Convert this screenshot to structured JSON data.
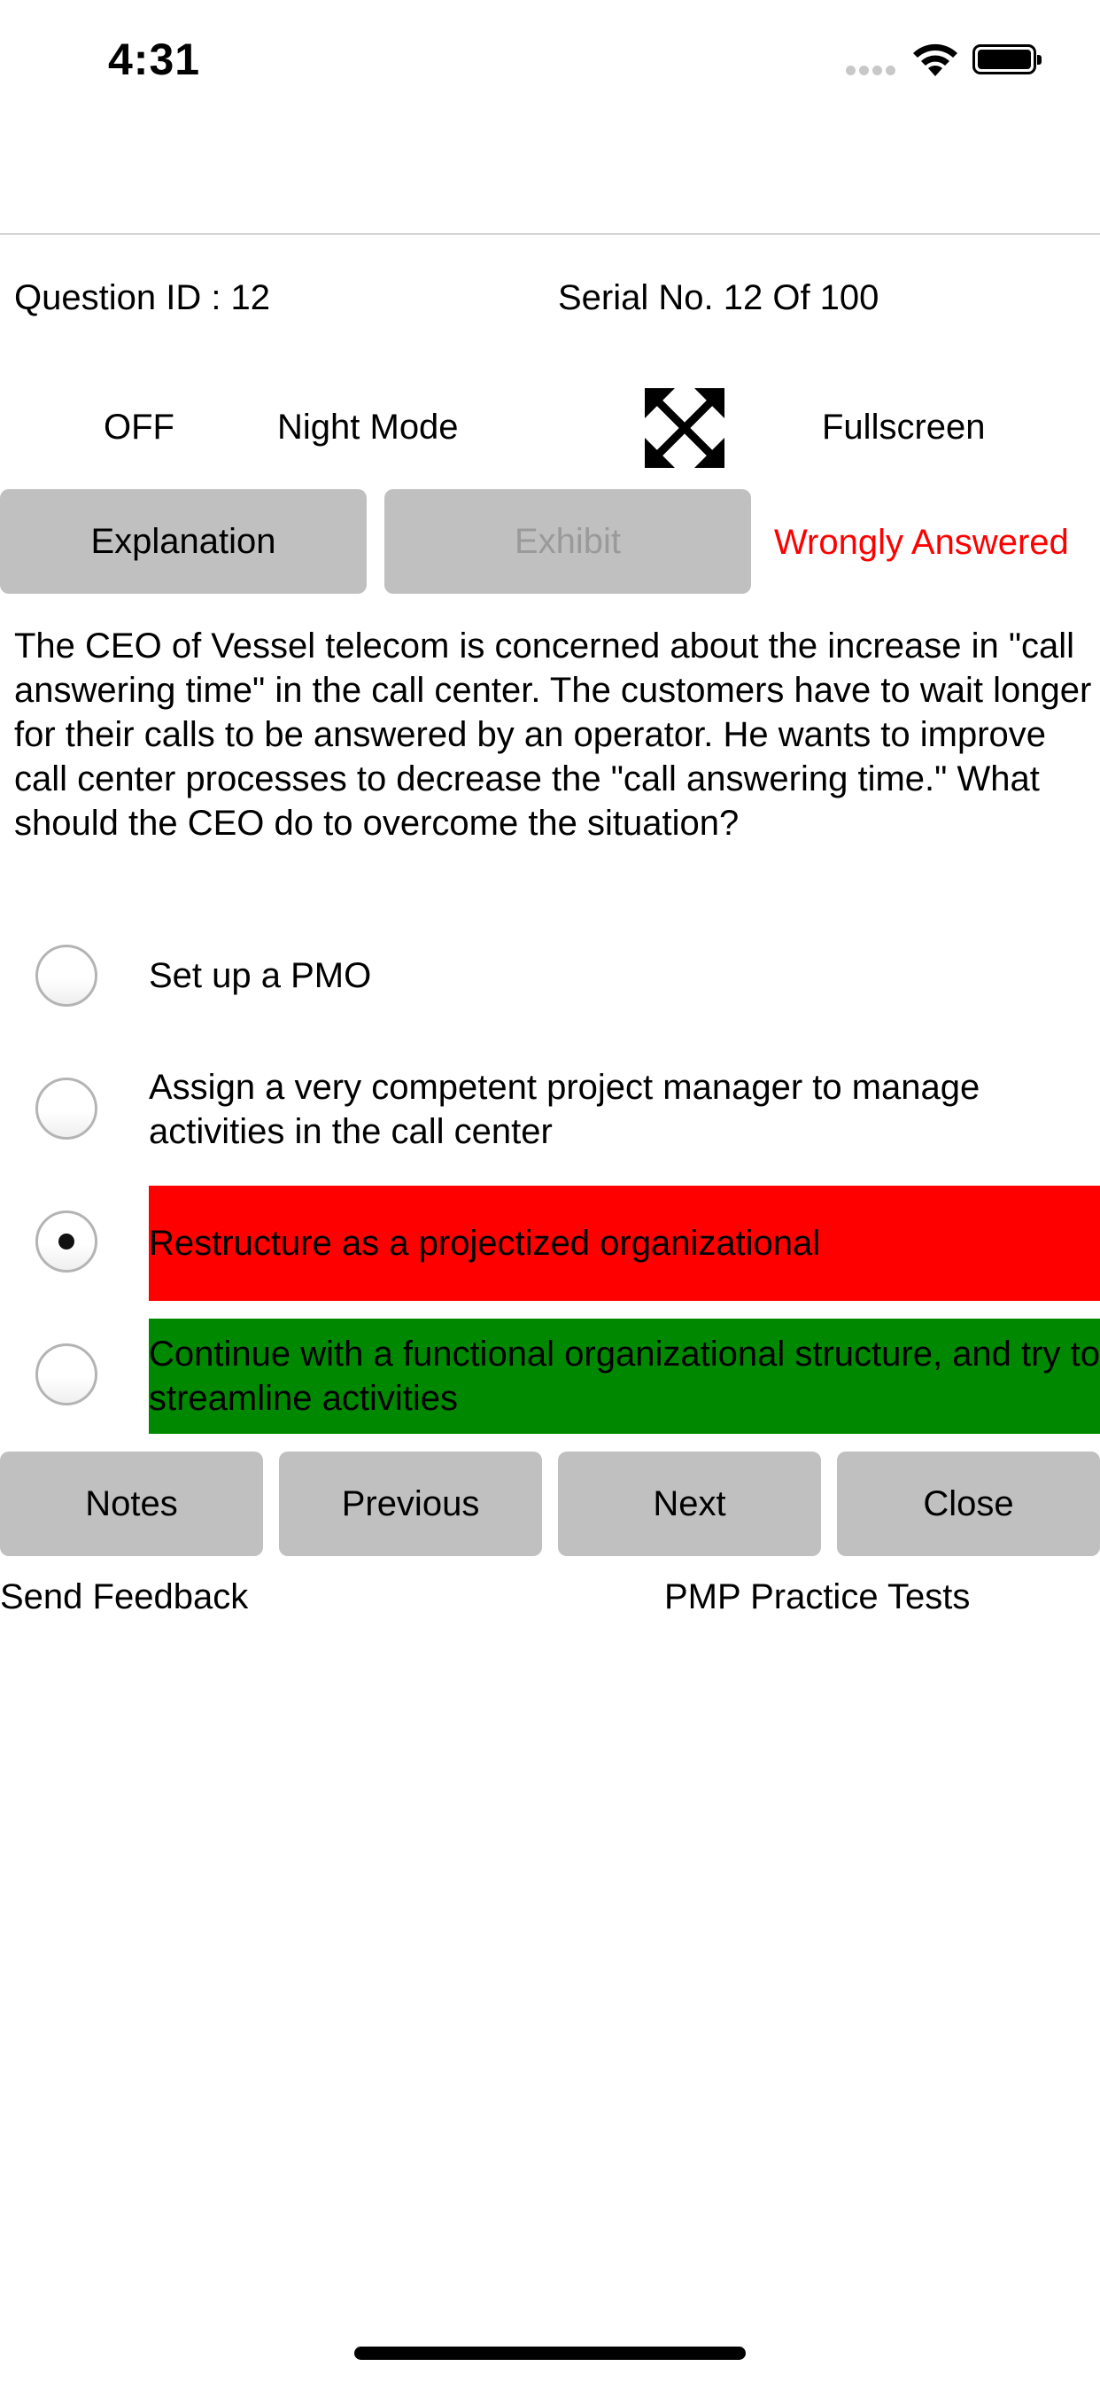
{
  "status_bar": {
    "time": "4:31",
    "icons": [
      "cellular-signal-icon",
      "wifi-icon",
      "battery-icon"
    ]
  },
  "header": {
    "question_id_label": "Question ID : 12",
    "serial_label": "Serial No. 12 Of 100"
  },
  "controls": {
    "night_mode_state": "OFF",
    "night_mode_label": "Night Mode",
    "fullscreen_icon": "expand-arrows-icon",
    "fullscreen_label": "Fullscreen"
  },
  "actions": {
    "explanation_label": "Explanation",
    "exhibit_label": "Exhibit",
    "answer_status": "Wrongly Answered"
  },
  "question": {
    "text": "The CEO of Vessel telecom is concerned about the increase in \"call answering time\" in the call center. The customers have to wait longer for their calls to be answered by an operator. He wants to improve call center processes to decrease the \"call answering time.\" What should the CEO do to overcome the situation?",
    "options": [
      {
        "text": "Set up a PMO",
        "selected": false,
        "state": "neutral"
      },
      {
        "text": "Assign a very competent project manager to manage activities in the call center",
        "selected": false,
        "state": "neutral"
      },
      {
        "text": "Restructure as a projectized organizational",
        "selected": true,
        "state": "wrong"
      },
      {
        "text": "Continue with a functional organizational structure, and try to streamline activities",
        "selected": false,
        "state": "correct"
      }
    ]
  },
  "nav": {
    "notes_label": "Notes",
    "previous_label": "Previous",
    "next_label": "Next",
    "close_label": "Close"
  },
  "footer": {
    "feedback_link": "Send Feedback",
    "app_name": "PMP Practice Tests"
  },
  "colors": {
    "wrong": "#ff0000",
    "correct": "#008800",
    "button_bg": "#c0c0c0",
    "status_text": "#ff0000"
  }
}
